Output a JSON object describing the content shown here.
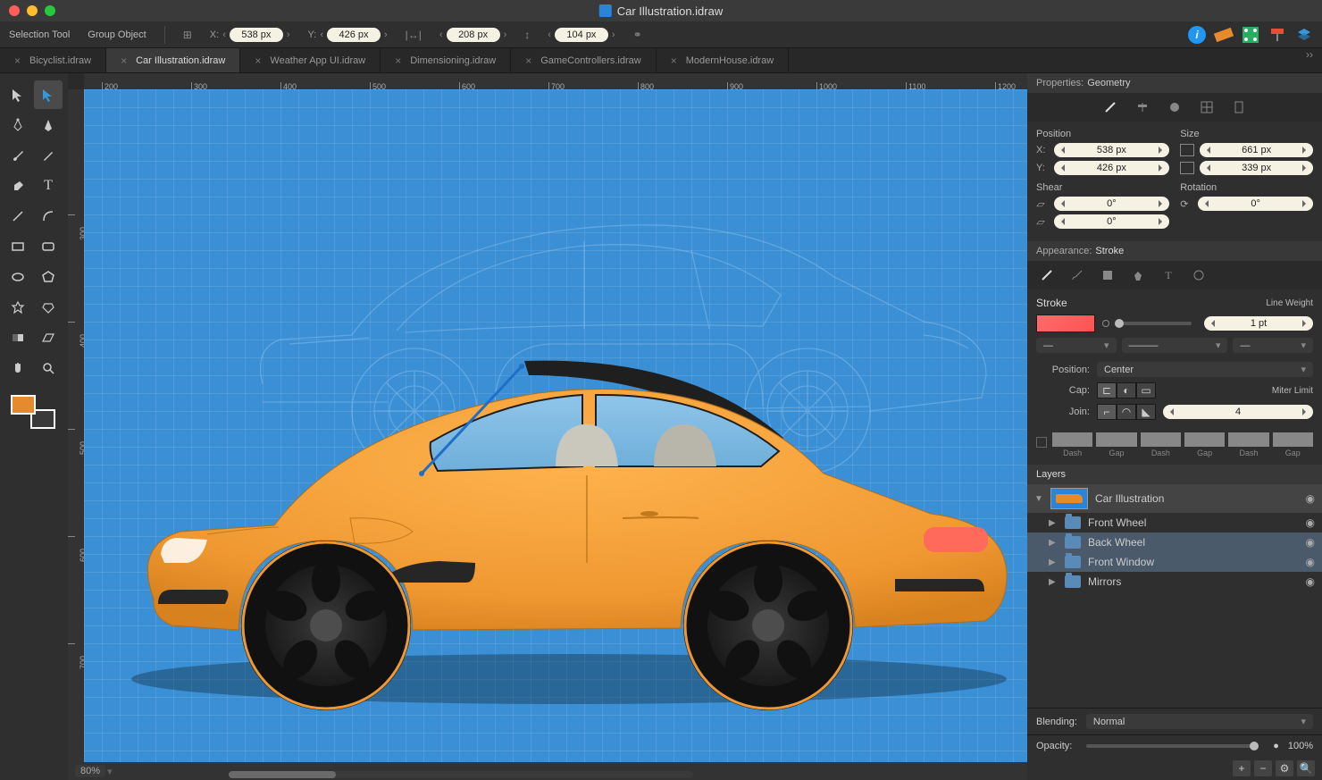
{
  "window": {
    "title": "Car Illustration.idraw"
  },
  "toolbar": {
    "selectionTool": "Selection Tool",
    "groupObject": "Group Object",
    "x": {
      "label": "X:",
      "value": "538 px"
    },
    "y": {
      "label": "Y:",
      "value": "426 px"
    },
    "w": {
      "label": "↔",
      "value": "208 px"
    },
    "h": {
      "label": "↕",
      "value": "104 px"
    }
  },
  "tabs": [
    {
      "name": "Bicyclist.idraw",
      "active": false
    },
    {
      "name": "Car Illustration.idraw",
      "active": true
    },
    {
      "name": "Weather App UI.idraw",
      "active": false
    },
    {
      "name": "Dimensioning.idraw",
      "active": false
    },
    {
      "name": "GameControllers.idraw",
      "active": false
    },
    {
      "name": "ModernHouse.idraw",
      "active": false
    }
  ],
  "rulerH": [
    200,
    300,
    400,
    500,
    600,
    700,
    800,
    900,
    1000,
    1100,
    1200
  ],
  "rulerV": [
    300,
    400,
    500,
    600,
    700
  ],
  "properties": {
    "header": {
      "label": "Properties:",
      "value": "Geometry"
    },
    "position": {
      "label": "Position",
      "x": "538 px",
      "y": "426 px",
      "xl": "X:",
      "yl": "Y:"
    },
    "size": {
      "label": "Size",
      "w": "661 px",
      "h": "339 px"
    },
    "shear": {
      "label": "Shear",
      "h": "0°",
      "v": "0°"
    },
    "rotation": {
      "label": "Rotation",
      "value": "0°"
    }
  },
  "appearance": {
    "header": {
      "label": "Appearance:",
      "value": "Stroke"
    },
    "strokeLabel": "Stroke",
    "lineWeightLabel": "Line Weight",
    "lineWeight": "1 pt",
    "positionLabel": "Position:",
    "position": "Center",
    "capLabel": "Cap:",
    "joinLabel": "Join:",
    "miterLabel": "Miter Limit",
    "miter": "4",
    "dashLabels": [
      "Dash",
      "Gap",
      "Dash",
      "Gap",
      "Dash",
      "Gap"
    ]
  },
  "layers": {
    "header": "Layers",
    "items": [
      {
        "name": "Car Illustration",
        "type": "root"
      },
      {
        "name": "Front Wheel",
        "type": "folder"
      },
      {
        "name": "Back Wheel",
        "type": "folder",
        "selected": true
      },
      {
        "name": "Front Window",
        "type": "folder",
        "selected": true
      },
      {
        "name": "Mirrors",
        "type": "folder"
      }
    ],
    "blendingLabel": "Blending:",
    "blending": "Normal",
    "opacityLabel": "Opacity:",
    "opacity": "100%"
  },
  "status": {
    "zoom": "80%"
  }
}
